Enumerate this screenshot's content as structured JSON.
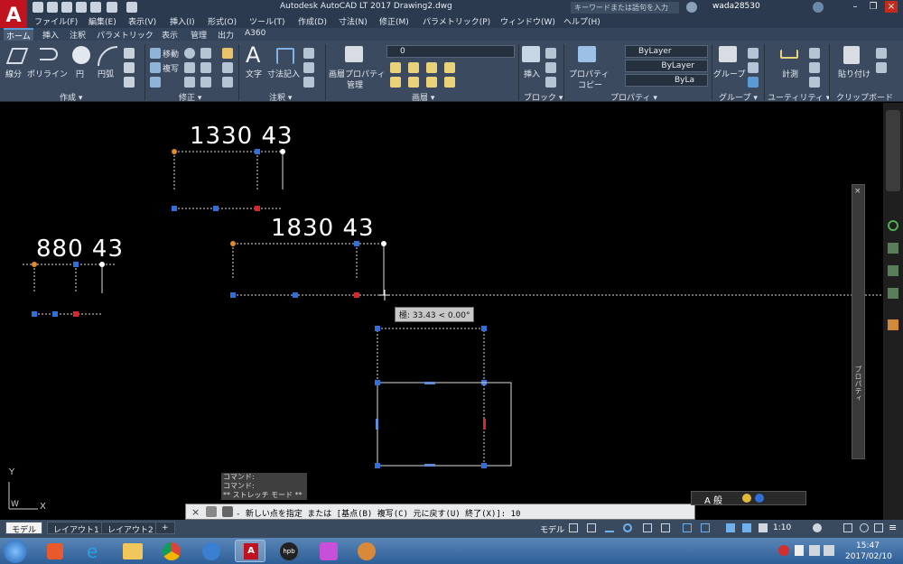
{
  "app": {
    "logo": "A",
    "logo_sub": "LT",
    "title": "Autodesk AutoCAD LT 2017    Drawing2.dwg",
    "search_placeholder": "キーワードまたは語句を入力",
    "user": "wada28530"
  },
  "menu": [
    "ファイル(F)",
    "編集(E)",
    "表示(V)",
    "挿入(I)",
    "形式(O)",
    "ツール(T)",
    "作成(D)",
    "寸法(N)",
    "修正(M)",
    "パラメトリック(P)",
    "ウィンドウ(W)",
    "ヘルプ(H)"
  ],
  "ribbon_tabs": [
    "ホーム",
    "挿入",
    "注釈",
    "パラメトリック",
    "表示",
    "管理",
    "出力",
    "A360"
  ],
  "ribbon": {
    "create": {
      "label": "作成 ▾",
      "line": "線分",
      "polyline": "ポリライン",
      "circle": "円",
      "arc": "円弧"
    },
    "modify": {
      "label": "修正 ▾",
      "move": "移動",
      "copy": "複写"
    },
    "annotation": {
      "label": "注釈 ▾",
      "text": "文字",
      "dimension": "寸法記入"
    },
    "layers": {
      "label": "画層 ▾",
      "properties": "画層プロパティ",
      "properties2": "管理",
      "current_layer": "0"
    },
    "block": {
      "label": "ブロック ▾",
      "insert": "挿入"
    },
    "properties": {
      "label": "プロパティ ▾",
      "match": "プロパティ",
      "match2": "コピー",
      "color": "ByLayer",
      "linetype": "ByLayer",
      "lineweight": "ByLa"
    },
    "groups": {
      "label": "グループ ▾",
      "group": "グループ"
    },
    "utilities": {
      "label": "ユーティリティ ▾",
      "measure": "計測"
    },
    "clipboard": {
      "label": "クリップボード",
      "paste": "貼り付け"
    }
  },
  "drawing": {
    "dim1_a": "1330",
    "dim1_b": "43",
    "dim2_a": "1830",
    "dim2_b": "43",
    "dim3_a": "880",
    "dim3_b": "43",
    "tooltip": "極: 33.43 < 0.00°",
    "ucs_y": "Y",
    "ucs_x": "X",
    "ucs_w": "W"
  },
  "command": {
    "history": [
      "コマンド:",
      "コマンド:",
      "** ストレッチ モード **"
    ],
    "prompt": "- 新しい点を指定 または [基点(B) 複写(C) 元に戻す(U) 終了(X)]: 10"
  },
  "side_palette": "プロパティ",
  "layout_tabs": [
    "モデル",
    "レイアウト1",
    "レイアウト2",
    "+"
  ],
  "status": {
    "model": "モデル",
    "scale": "1:10"
  },
  "taskbar": {
    "time": "15:47",
    "date": "2017/02/10"
  }
}
